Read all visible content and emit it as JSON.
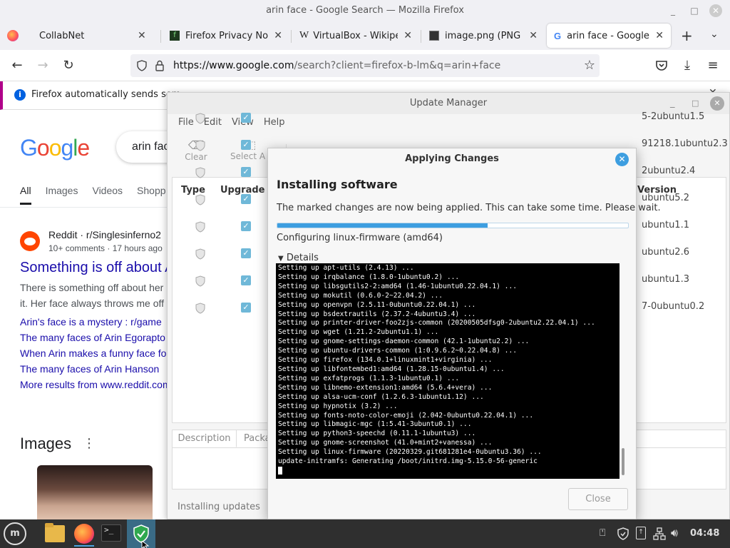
{
  "firefox": {
    "window_title": "arin face - Google Search — Mozilla Firefox",
    "tabs": [
      {
        "label": "CollabNet"
      },
      {
        "label": "Firefox Privacy Notic"
      },
      {
        "label": "VirtualBox - Wikiped"
      },
      {
        "label": "image.png (PNG Ima"
      },
      {
        "label": "arin face - Google Se"
      }
    ],
    "url_host": "https://www.google.com",
    "url_path": "/search?client=firefox-b-lm&q=arin+face",
    "notification": "Firefox automatically sends som"
  },
  "google": {
    "logo": "Google",
    "search_value": "arin fac",
    "tabs": [
      "All",
      "Images",
      "Videos",
      "Shopp"
    ],
    "result": {
      "source": "Reddit · r/Singlesinferno2",
      "meta": "10+ comments · 17 hours ago",
      "title": "Something is off about A",
      "snippet1": "There is something off about her",
      "snippet2": "it. Her face always throws me off",
      "links": [
        "Arin's face is a mystery : r/game",
        "The many faces of Arin Egorapto",
        "When Arin makes a funny face fo",
        "The many faces of Arin Hanson"
      ],
      "more": "More results from www.reddit.com"
    },
    "images_heading": "Images"
  },
  "update_manager": {
    "title": "Update Manager",
    "menu": [
      "File",
      "Edit",
      "View",
      "Help"
    ],
    "toolbar": {
      "clear": "Clear",
      "select_all": "Select A"
    },
    "columns": {
      "type": "Type",
      "upgrade": "Upgrade",
      "version": "Version"
    },
    "versions": [
      "5-2ubuntu1.5",
      "91218.1ubuntu2.3",
      "2ubuntu2.4",
      "ubuntu5.2",
      "ubuntu1.1",
      "ubuntu2.6",
      "ubuntu1.3",
      "7-0ubuntu0.2"
    ],
    "bottom_tabs": [
      "Description",
      "Packa"
    ],
    "status": "Installing updates"
  },
  "dialog": {
    "title": "Applying Changes",
    "heading": "Installing software",
    "description": "The marked changes are now being applied. This can take some time. Please wait.",
    "progress": 0.6,
    "status": "Configuring linux-firmware (amd64)",
    "details_label": "Details",
    "terminal_lines": [
      "Setting up apt-utils (2.4.13) ...",
      "Setting up irqbalance (1.8.0-1ubuntu0.2) ...",
      "Setting up libsgutils2-2:amd64 (1.46-1ubuntu0.22.04.1) ...",
      "Setting up mokutil (0.6.0-2~22.04.2) ...",
      "Setting up openvpn (2.5.11-0ubuntu0.22.04.1) ...",
      "Setting up bsdextrautils (2.37.2-4ubuntu3.4) ...",
      "Setting up printer-driver-foo2zjs-common (20200505dfsg0-2ubuntu2.22.04.1) ...",
      "Setting up wget (1.21.2-2ubuntu1.1) ...",
      "Setting up gnome-settings-daemon-common (42.1-1ubuntu2.2) ...",
      "Setting up ubuntu-drivers-common (1:0.9.6.2~0.22.04.8) ...",
      "Setting up firefox (134.0.1+linuxmint1+virginia) ...",
      "Setting up libfontembed1:amd64 (1.28.15-0ubuntu1.4) ...",
      "Setting up exfatprogs (1.1.3-1ubuntu0.1) ...",
      "Setting up libnemo-extension1:amd64 (5.6.4+vera) ...",
      "Setting up alsa-ucm-conf (1.2.6.3-1ubuntu1.12) ...",
      "Setting up hypnotix (3.2) ...",
      "Setting up fonts-noto-color-emoji (2.042-0ubuntu0.22.04.1) ...",
      "Setting up libmagic-mgc (1:5.41-3ubuntu0.1) ...",
      "Setting up python3-speechd (0.11.1-1ubuntu3) ...",
      "Setting up gnome-screenshot (41.0+mint2+vanessa) ...",
      "Setting up linux-firmware (20220329.git681281e4-0ubuntu3.36) ...",
      "update-initramfs: Generating /boot/initrd.img-5.15.0-56-generic"
    ],
    "close_button": "Close"
  },
  "taskbar": {
    "clock": "04:48"
  },
  "colors": {
    "accent": "#3d9ee0",
    "google_link": "#1a0dab",
    "notification_stripe": "#b0008a",
    "taskbar": "#2f2f2f"
  }
}
